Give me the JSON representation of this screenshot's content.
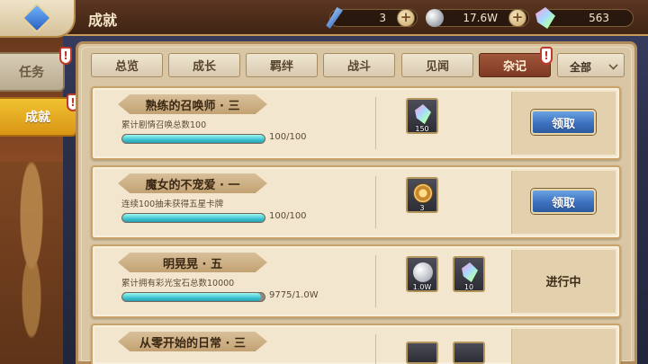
{
  "header": {
    "title": "成就",
    "resources": [
      {
        "name": "quill-currency",
        "value": "3"
      },
      {
        "name": "silver-currency",
        "value": "17.6W"
      },
      {
        "name": "crystal-currency",
        "value": "563"
      }
    ]
  },
  "side_tabs": [
    {
      "label": "任务",
      "active": false
    },
    {
      "label": "成就",
      "active": true
    }
  ],
  "tabs": [
    "总览",
    "成长",
    "羁绊",
    "战斗",
    "见闻",
    "杂记"
  ],
  "active_tab": "杂记",
  "filter": {
    "selected": "全部"
  },
  "achievements": [
    {
      "title": "熟练的召唤师 · 三",
      "desc": "累计剧情召唤总数100",
      "progress_text": "100/100",
      "progress": 1.0,
      "rewards": [
        {
          "icon": "crystal-icon",
          "count": "150"
        }
      ],
      "action": "领取"
    },
    {
      "title": "魔女的不宠爱 · 一",
      "desc": "连续100抽未获得五星卡牌",
      "progress_text": "100/100",
      "progress": 1.0,
      "rewards": [
        {
          "icon": "medal-icon",
          "count": "3"
        }
      ],
      "action": "领取"
    },
    {
      "title": "明晃晃 · 五",
      "desc": "累计拥有彩光宝石总数10000",
      "progress_text": "9775/1.0W",
      "progress": 0.9775,
      "rewards": [
        {
          "icon": "silver-coin-icon",
          "count": "1.0W"
        },
        {
          "icon": "crystal-icon",
          "count": "10"
        }
      ],
      "action": "进行中"
    },
    {
      "title": "从零开始的日常 · 三"
    }
  ]
}
